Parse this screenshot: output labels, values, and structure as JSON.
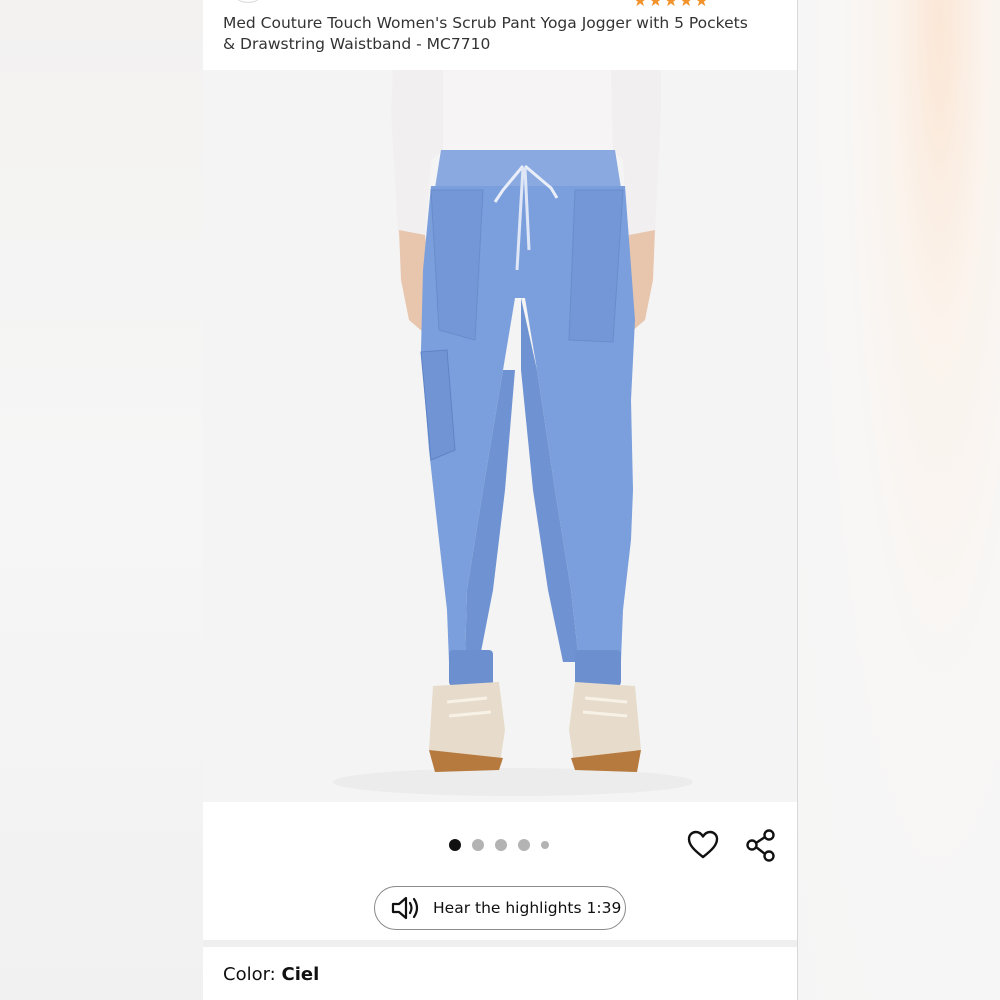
{
  "product": {
    "title": "Med Couture Touch Women's Scrub Pant Yoga Jogger with 5 Pockets & Drawstring Waistband - MC7710",
    "rating_stars": "★★★★★",
    "image_count": 5,
    "active_image": 1
  },
  "actions": {
    "hear_highlights_label": "Hear the highlights 1:39",
    "heart_icon": "heart-outline-icon",
    "share_icon": "share-icon",
    "speaker_icon": "speaker-icon"
  },
  "variant": {
    "color_label": "Color:",
    "color_value": "Ciel"
  },
  "colors": {
    "pant_blue": "#7b9fdc",
    "star_orange": "#f1922a",
    "active_dot": "#111111",
    "inactive_dot": "#b3b3b3"
  }
}
